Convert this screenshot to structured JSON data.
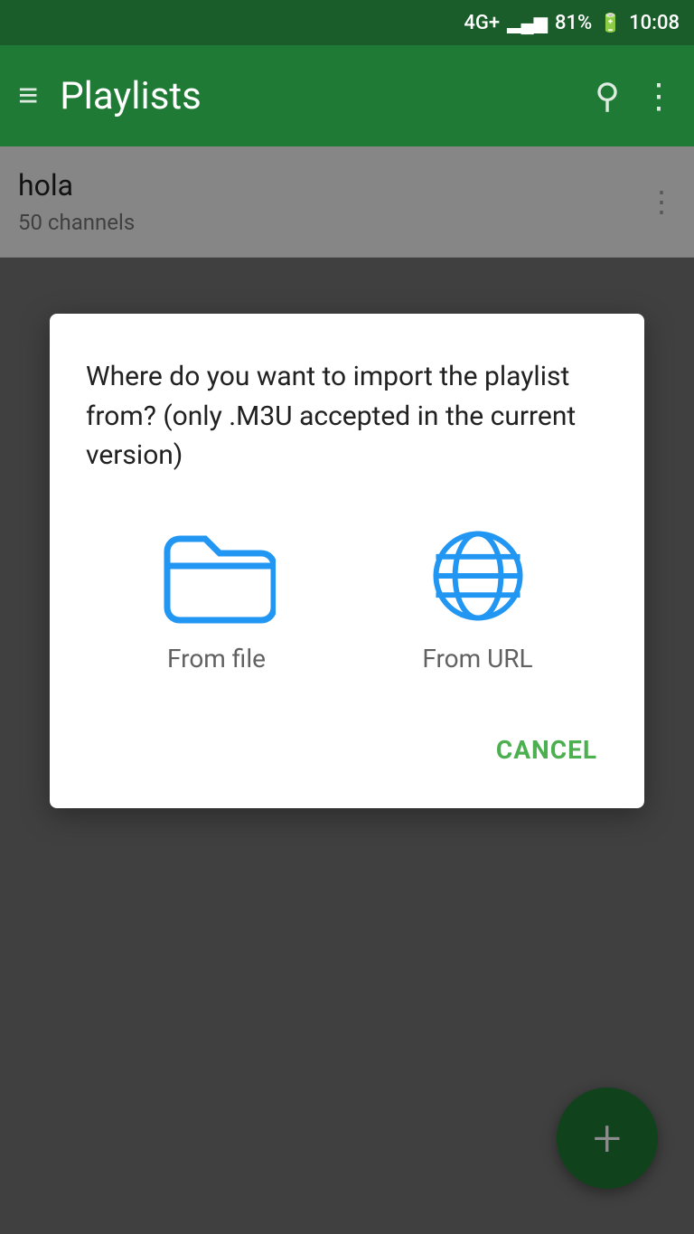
{
  "status_bar": {
    "network": "4G+",
    "signal_bars": "▂▄▆█",
    "battery": "81%",
    "time": "10:08"
  },
  "app_bar": {
    "title": "Playlists",
    "menu_icon": "≡",
    "search_icon": "🔍",
    "more_icon": "⋮"
  },
  "playlist": {
    "name": "hola",
    "channels": "50 channels",
    "more_icon": "⋮"
  },
  "dialog": {
    "message": "Where do you want to import the playlist from? (only .M3U accepted in the current version)",
    "option_file_label": "From file",
    "option_url_label": "From URL",
    "cancel_label": "CANCEL"
  },
  "fab": {
    "icon": "+"
  },
  "colors": {
    "app_bar": "#1e7a34",
    "status_bar": "#1a5c2a",
    "accent_green": "#4caf50",
    "icon_blue": "#2196F3"
  }
}
